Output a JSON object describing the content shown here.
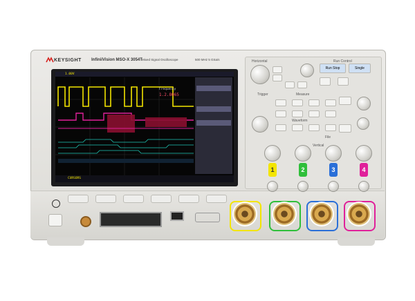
{
  "brand": {
    "name": "KEYSIGHT",
    "logo_color": "#d6231e"
  },
  "model": {
    "name": "InfiniiVision MSO-X 3054T",
    "subtitle": "Mixed Signal Oscilloscope",
    "specs": "500 MHz  5 GSa/s"
  },
  "screen": {
    "top_left_value": "1.00V",
    "freq_readout": "1.2.8065",
    "menu_title": "Frequency",
    "status_left": "CURSORS",
    "channel_colors": [
      "#f3e500",
      "#2fbf3a",
      "#2a6fd8",
      "#e0209a"
    ],
    "digital_color": "#1fc8b5"
  },
  "channels": [
    {
      "label": "1",
      "color": "#f3e500"
    },
    {
      "label": "2",
      "color": "#2fbf3a"
    },
    {
      "label": "3",
      "color": "#2a6fd8"
    },
    {
      "label": "4",
      "color": "#e0209a"
    }
  ],
  "panel": {
    "horizontal_label": "Horizontal",
    "run_control_label": "Run Control",
    "trigger_label": "Trigger",
    "measure_label": "Measure",
    "waveform_label": "Waveform",
    "file_label": "File",
    "vertical_label": "Vertical",
    "run_stop": "Run Stop",
    "single": "Single"
  },
  "icons": [
    "power-icon",
    "usb-icon"
  ]
}
